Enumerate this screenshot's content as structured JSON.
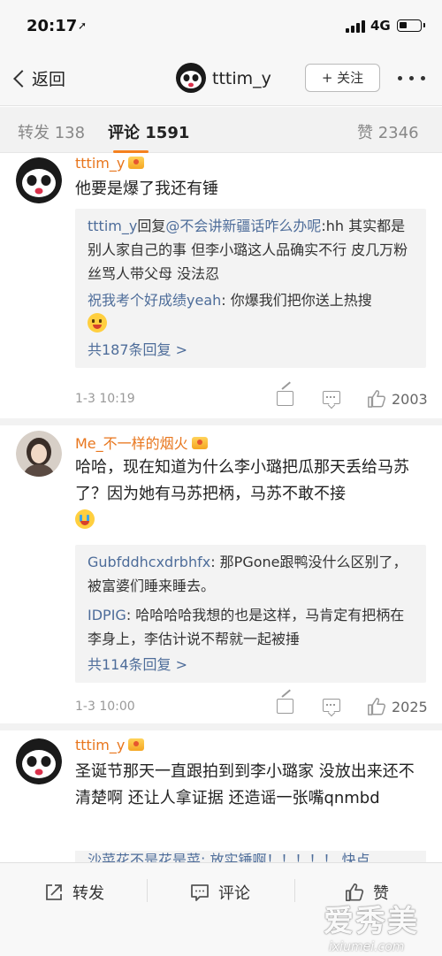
{
  "status_bar": {
    "time": "20:17",
    "network": "4G"
  },
  "nav": {
    "back_label": "返回",
    "username": "tttim_y",
    "follow_label": "+ 关注"
  },
  "tabs": [
    {
      "label": "转发 138"
    },
    {
      "label": "评论 1591"
    },
    {
      "label": "赞 2346"
    }
  ],
  "comments": [
    {
      "name": "tttim_y",
      "text": "他要是爆了我还有锤",
      "replies": [
        {
          "who": "tttim_y",
          "mid": "回复",
          "at": "@不会讲新疆话咋么办呢",
          "text": ":hh 其实都是别人家自己的事 但李小璐这人品确实不行 皮几万粉丝骂人带父母 没法忍"
        },
        {
          "who": "祝我考个好成绩yeah",
          "text": ": 你爆我们把你送上热搜"
        }
      ],
      "more_replies": "共187条回复 >",
      "time": "1-3 10:19",
      "likes": "2003"
    },
    {
      "name": "Me_不一样的烟火",
      "text": "哈哈，现在知道为什么李小璐把瓜那天丢给马苏了？因为她有马苏把柄，马苏不敢不接",
      "replies": [
        {
          "who": "Gubfddhcxdrbhfx",
          "text": ": 那PGone跟鸭没什么区别了，被富婆们睡来睡去。"
        },
        {
          "who": "IDPIG",
          "text": ": 哈哈哈哈我想的也是这样，马肯定有把柄在李身上，李估计说不帮就一起被捶"
        }
      ],
      "more_replies": "共114条回复 >",
      "time": "1-3 10:00",
      "likes": "2025"
    },
    {
      "name": "tttim_y",
      "text": "圣诞节那天一直跟拍到到李小璐家 没放出来还不清楚啊 还让人拿证据 还造谣一张嘴qnmbd",
      "peek_reply": "沙菜花不是花是菜: 放实锤啊！！！！！ 快点"
    }
  ],
  "bottom_bar": {
    "repost": "转发",
    "comment": "评论",
    "like": "赞"
  },
  "watermark": {
    "main": "爱秀美",
    "sub": "ixiumei.com"
  }
}
